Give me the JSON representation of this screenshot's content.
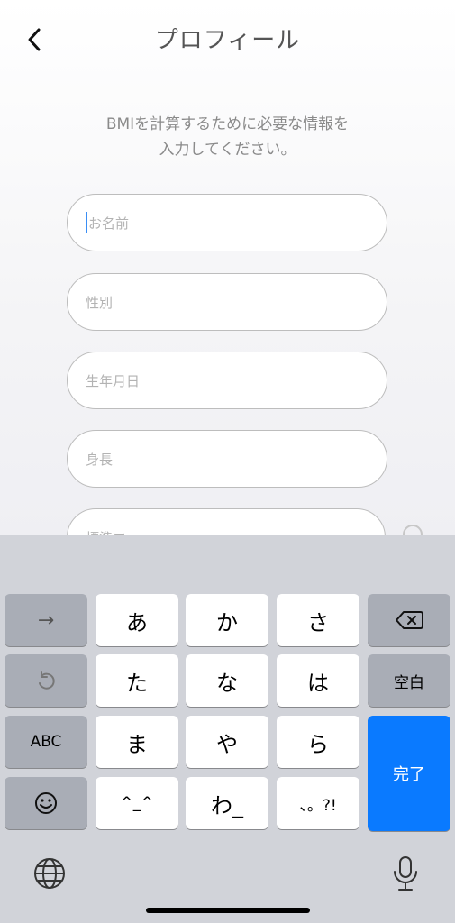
{
  "header": {
    "title": "プロフィール"
  },
  "instruction": {
    "line1": "BMIを計算するために必要な情報を",
    "line2": "入力してください。"
  },
  "form": {
    "fields": [
      {
        "placeholder": "お名前"
      },
      {
        "placeholder": "性別"
      },
      {
        "placeholder": "生年月日"
      },
      {
        "placeholder": "身長"
      },
      {
        "placeholder": "標準エ..."
      }
    ]
  },
  "keyboard": {
    "row1": {
      "a": "あ",
      "ka": "か",
      "sa": "さ"
    },
    "row2": {
      "ta": "た",
      "na": "な",
      "ha": "は",
      "space": "空白"
    },
    "row3": {
      "abc": "ABC",
      "ma": "ま",
      "ya": "や",
      "ra": "ら"
    },
    "row4": {
      "kaomoji": "^_^",
      "wa": "わ_",
      "punct": "、。?!"
    },
    "done": "完了",
    "next_arrow": "→"
  },
  "colors": {
    "accent": "#0a7aff",
    "caret": "#3a8ef5"
  }
}
